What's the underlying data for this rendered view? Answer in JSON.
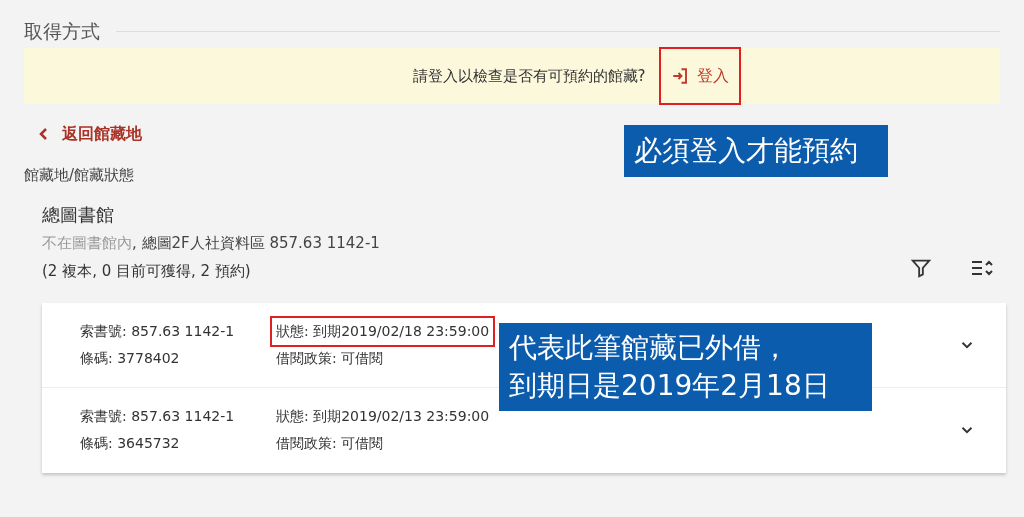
{
  "section_title": "取得方式",
  "login_banner": {
    "message": "請登入以檢查是否有可預約的館藏?",
    "login_link": "登入",
    "highlighted": true
  },
  "back_link": "返回館藏地",
  "location_heading": "館藏地/館藏狀態",
  "library": {
    "name": "總圖書館",
    "availability": "不在圖書館內",
    "location": ", 總圖2F人社資料區 857.63 1142-1",
    "summary": "(2 複本, 0 目前可獲得, 2 預約)"
  },
  "items": [
    {
      "call_number": "索書號: 857.63 1142-1",
      "status": "狀態: 到期2019/02/18 23:59:00",
      "barcode": "條碼: 3778402",
      "policy": "借閱政策: 可借閱",
      "expanded": false,
      "highlighted": true
    },
    {
      "call_number": "索書號: 857.63 1142-1",
      "status": "狀態: 到期2019/02/13 23:59:00",
      "barcode": "條碼: 3645732",
      "policy": "借閱政策: 可借閱",
      "expanded": false,
      "highlighted": false
    }
  ],
  "annotations": [
    {
      "kind": "callout",
      "lines": [
        "必須登入才能預約"
      ]
    },
    {
      "kind": "callout",
      "lines": [
        "代表此筆館藏已外借，",
        "到期日是2019年2月18日"
      ]
    }
  ]
}
